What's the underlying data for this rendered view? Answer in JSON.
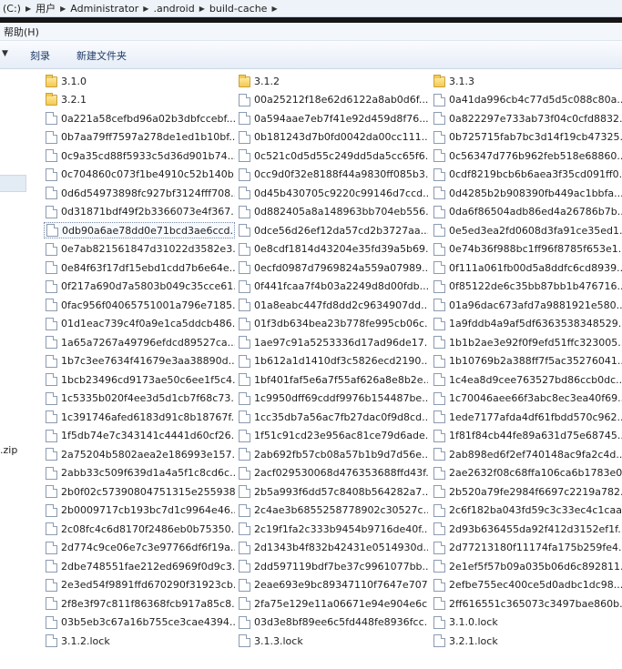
{
  "address": {
    "crumbs": [
      "(C:)",
      "用户",
      "Administrator",
      ".android",
      "build-cache"
    ]
  },
  "menu": {
    "help": "帮助(H)"
  },
  "toolbar": {
    "burn": "刻录",
    "new_folder": "新建文件夹"
  },
  "nav": {
    "zip_label": ".zip"
  },
  "files": [
    {
      "name": "3.1.0",
      "type": "folder"
    },
    {
      "name": "3.1.2",
      "type": "folder"
    },
    {
      "name": "3.1.3",
      "type": "folder"
    },
    {
      "name": "3.2.1",
      "type": "folder"
    },
    {
      "name": "00a25212f18e62d6122a8ab0d6f...",
      "type": "file"
    },
    {
      "name": "0a41da996cb4c77d5d5c088c80a...",
      "type": "file"
    },
    {
      "name": "0a221a58cefbd96a02b3dbfccebf...",
      "type": "file"
    },
    {
      "name": "0a594aae7eb7f41e92d459d8f76...",
      "type": "file"
    },
    {
      "name": "0a822297e733ab73f04c0cfd8832...",
      "type": "file"
    },
    {
      "name": "0b7aa79ff7597a278de1ed1b10bf...",
      "type": "file"
    },
    {
      "name": "0b181243d7b0fd0042da00cc111...",
      "type": "file"
    },
    {
      "name": "0b725715fab7bc3d14f19cb47325...",
      "type": "file"
    },
    {
      "name": "0c9a35cd88f5933c5d36d901b74...",
      "type": "file"
    },
    {
      "name": "0c521c0d5d55c249dd5da5cc65f6...",
      "type": "file"
    },
    {
      "name": "0c56347d776b962feb518e68860...",
      "type": "file"
    },
    {
      "name": "0c704860c073f1be4910c52b140b...",
      "type": "file"
    },
    {
      "name": "0cc9d0f32e8188f44a9830ff085b3...",
      "type": "file"
    },
    {
      "name": "0cdf8219bcb6b6aea3f35cd091ff0...",
      "type": "file"
    },
    {
      "name": "0d6d54973898fc927bf3124fff708...",
      "type": "file"
    },
    {
      "name": "0d45b430705c9220c99146d7ccd...",
      "type": "file"
    },
    {
      "name": "0d4285b2b908390fb449ac1bbfa...",
      "type": "file"
    },
    {
      "name": "0d31871bdf49f2b3366073e4f367...",
      "type": "file"
    },
    {
      "name": "0d882405a8a148963bb704eb556...",
      "type": "file"
    },
    {
      "name": "0da6f86504adb86ed4a26786b7b...",
      "type": "file"
    },
    {
      "name": "0db90a6ae78dd0e71bcd3ae6ccd...",
      "type": "file",
      "selected": true
    },
    {
      "name": "0dce56d26ef12da57cd2b3727aa...",
      "type": "file"
    },
    {
      "name": "0e5ed3ea2fd0608d3fa91ce35ed1...",
      "type": "file"
    },
    {
      "name": "0e7ab821561847d31022d3582e3...",
      "type": "file"
    },
    {
      "name": "0e8cdf1814d43204e35fd39a5b69...",
      "type": "file"
    },
    {
      "name": "0e74b36f988bc1ff96f8785f653e1...",
      "type": "file"
    },
    {
      "name": "0e84f63f17df15ebd1cdd7b6e64e...",
      "type": "file"
    },
    {
      "name": "0ecfd0987d7969824a559a07989...",
      "type": "file"
    },
    {
      "name": "0f111a061fb00d5a8ddfc6cd8939...",
      "type": "file"
    },
    {
      "name": "0f217a690d7a5803b049c35cce61...",
      "type": "file"
    },
    {
      "name": "0f441fcaa7f4b03a2249d8d00fdb...",
      "type": "file"
    },
    {
      "name": "0f85122de6c35bb87bb1b476716...",
      "type": "file"
    },
    {
      "name": "0fac956f04065751001a796e7185...",
      "type": "file"
    },
    {
      "name": "01a8eabc447fd8dd2c9634907dd...",
      "type": "file"
    },
    {
      "name": "01a96dac673afd7a9881921e580...",
      "type": "file"
    },
    {
      "name": "01d1eac739c4f0a9e1ca5ddcb486...",
      "type": "file"
    },
    {
      "name": "01f3db634bea23b778fe995cb06c...",
      "type": "file"
    },
    {
      "name": "1a9fddb4a9af5df6363538348529...",
      "type": "file"
    },
    {
      "name": "1a65a7267a49796efdcd89527ca...",
      "type": "file"
    },
    {
      "name": "1ae97c91a5253336d17ad96de17...",
      "type": "file"
    },
    {
      "name": "1b1b2ae3e92f0f9efd51ffc323005...",
      "type": "file"
    },
    {
      "name": "1b7c3ee7634f41679e3aa38890d...",
      "type": "file"
    },
    {
      "name": "1b612a1d1410df3c5826ecd2190...",
      "type": "file"
    },
    {
      "name": "1b10769b2a388ff7f5ac35276041...",
      "type": "file"
    },
    {
      "name": "1bcb23496cd9173ae50c6ee1f5c4...",
      "type": "file"
    },
    {
      "name": "1bf401faf5e6a7f55af626a8e8b2e...",
      "type": "file"
    },
    {
      "name": "1c4ea8d9cee763527bd86ccb0dc...",
      "type": "file"
    },
    {
      "name": "1c5335b020f4ee3d5d1cb7f68c73...",
      "type": "file"
    },
    {
      "name": "1c9950dff69cddf9976b154487be...",
      "type": "file"
    },
    {
      "name": "1c70046aee66f3abc8ec3ea40f69...",
      "type": "file"
    },
    {
      "name": "1c391746afed6183d91c8b18767f...",
      "type": "file"
    },
    {
      "name": "1cc35db7a56ac7fb27dac0f9d8cd...",
      "type": "file"
    },
    {
      "name": "1ede7177afda4df61fbdd570c962...",
      "type": "file"
    },
    {
      "name": "1f5db74e7c343141c4441d60cf26...",
      "type": "file"
    },
    {
      "name": "1f51c91cd23e956ac81ce79d6ade...",
      "type": "file"
    },
    {
      "name": "1f81f84cb44fe89a631d75e68745...",
      "type": "file"
    },
    {
      "name": "2a75204b5802aea2e186993e157...",
      "type": "file"
    },
    {
      "name": "2ab692fb57cb08a57b1b9d7d56e...",
      "type": "file"
    },
    {
      "name": "2ab898ed6f2ef740148ac9fa2c4d...",
      "type": "file"
    },
    {
      "name": "2abb33c509f639d1a4a5f1c8cd6c...",
      "type": "file"
    },
    {
      "name": "2acf029530068d476353688ffd43f...",
      "type": "file"
    },
    {
      "name": "2ae2632f08c68ffa106ca6b1783e0...",
      "type": "file"
    },
    {
      "name": "2b0f02c57390804751315e255938...",
      "type": "file"
    },
    {
      "name": "2b5a993f6dd57c8408b564282a7...",
      "type": "file"
    },
    {
      "name": "2b520a79fe2984f6697c2219a782...",
      "type": "file"
    },
    {
      "name": "2b0009717cb193bc7d1c9964e46...",
      "type": "file"
    },
    {
      "name": "2c4ae3b6855258778902c30527c...",
      "type": "file"
    },
    {
      "name": "2c6f182ba043fd59c3c33ec4c1caa...",
      "type": "file"
    },
    {
      "name": "2c08fc4c6d8170f2486eb0b75350...",
      "type": "file"
    },
    {
      "name": "2c19f1fa2c333b9454b9716de40f...",
      "type": "file"
    },
    {
      "name": "2d93b636455da92f412d3152ef1f...",
      "type": "file"
    },
    {
      "name": "2d774c9ce06e7c3e97766df6f19a...",
      "type": "file"
    },
    {
      "name": "2d1343b4f832b42431e0514930d...",
      "type": "file"
    },
    {
      "name": "2d77213180f11174fa175b259fe4...",
      "type": "file"
    },
    {
      "name": "2dbe748551fae212ed6969f0d9c3...",
      "type": "file"
    },
    {
      "name": "2dd597119bdf7be37c9961077bb...",
      "type": "file"
    },
    {
      "name": "2e1ef5f57b09a035b06d6c892811...",
      "type": "file"
    },
    {
      "name": "2e3ed54f9891ffd670290f31923cb...",
      "type": "file"
    },
    {
      "name": "2eae693e9bc89347110f7647e707...",
      "type": "file"
    },
    {
      "name": "2efbe755ec400ce5d0adbc1dc98...",
      "type": "file"
    },
    {
      "name": "2f8e3f97c811f86368fcb917a85c8...",
      "type": "file"
    },
    {
      "name": "2fa75e129e11a06671e94e904e6c...",
      "type": "file"
    },
    {
      "name": "2ff616551c365073c3497bae860b...",
      "type": "file"
    },
    {
      "name": "03b5eb3c67a16b755ce3cae4394...",
      "type": "file"
    },
    {
      "name": "03d3e8bf89ee6c5fd448fe8936fcc...",
      "type": "file"
    },
    {
      "name": "3.1.0.lock",
      "type": "file"
    },
    {
      "name": "3.1.2.lock",
      "type": "file"
    },
    {
      "name": "3.1.3.lock",
      "type": "file"
    },
    {
      "name": "3.2.1.lock",
      "type": "file"
    }
  ]
}
